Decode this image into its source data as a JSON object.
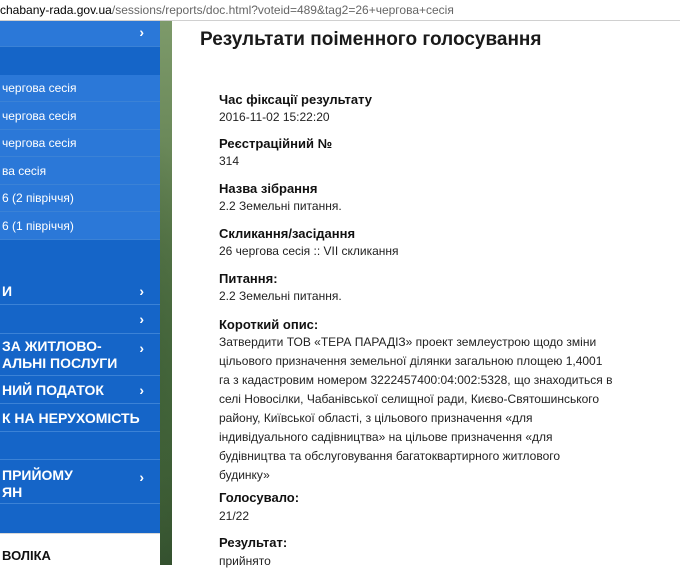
{
  "browser": {
    "url_host": "chabany-rada.gov.ua",
    "url_path": "/sessions/reports/doc.html?voteid=489&tag2=26+чергова+сесія"
  },
  "sidebar": {
    "top_chevron": "›",
    "session_items": [
      "чергова сесія",
      "чергова сесія",
      "чергова сесія",
      "ва сесія",
      "6 (2 півріччя)",
      "6 (1 півріччя)"
    ],
    "main_items": [
      {
        "label": "И",
        "chevron": "›"
      },
      {
        "label": "",
        "chevron": "›"
      },
      {
        "label_line1": "ЗА ЖИТЛОВО-",
        "label_line2": "АЛЬНІ ПОСЛУГИ",
        "chevron": "›"
      },
      {
        "label": "НИЙ ПОДАТОК",
        "chevron": "›"
      },
      {
        "label": "К НА НЕРУХОМІСТЬ",
        "chevron": ""
      },
      {
        "label": "",
        "chevron": ""
      },
      {
        "label_line1": "ПРИЙОМУ",
        "label_line2": "ЯН",
        "chevron": "›"
      }
    ],
    "footer_text": "ВОЛІКА"
  },
  "report": {
    "title": "Результати поіменного голосування",
    "fields": [
      {
        "label": "Час фіксації результату",
        "value": "2016-11-02 15:22:20"
      },
      {
        "label": "Реєстраційний №",
        "value": "314"
      },
      {
        "label": "Назва зібрання",
        "value": "2.2 Земельні питання."
      },
      {
        "label": "Скликання/засідання",
        "value": "26 чергова сесія :: VII скликання"
      },
      {
        "label": "Питання:",
        "value": "2.2 Земельні питання."
      },
      {
        "label": "Короткий опис:",
        "value_lines": [
          "Затвердити ТОВ «ТЕРА ПАРАДІЗ» проект землеустрою щодо зміни",
          "цільового призначення земельної ділянки загальною площею 1,4001",
          "га з кадастровим номером 3222457400:04:002:5328, що знаходиться в",
          "селі Новосілки, Чабанівської селищної ради, Києво-Святошинського",
          "району, Київської області, з цільового призначення «для",
          "індивідуального садівництва» на цільове призначення «для",
          "будівництва та обслуговування багатоквартирного житлового",
          "будинку»"
        ]
      },
      {
        "label": "Голосувало:",
        "value": "21/22"
      },
      {
        "label": "Результат:",
        "value": "прийнято"
      }
    ]
  }
}
